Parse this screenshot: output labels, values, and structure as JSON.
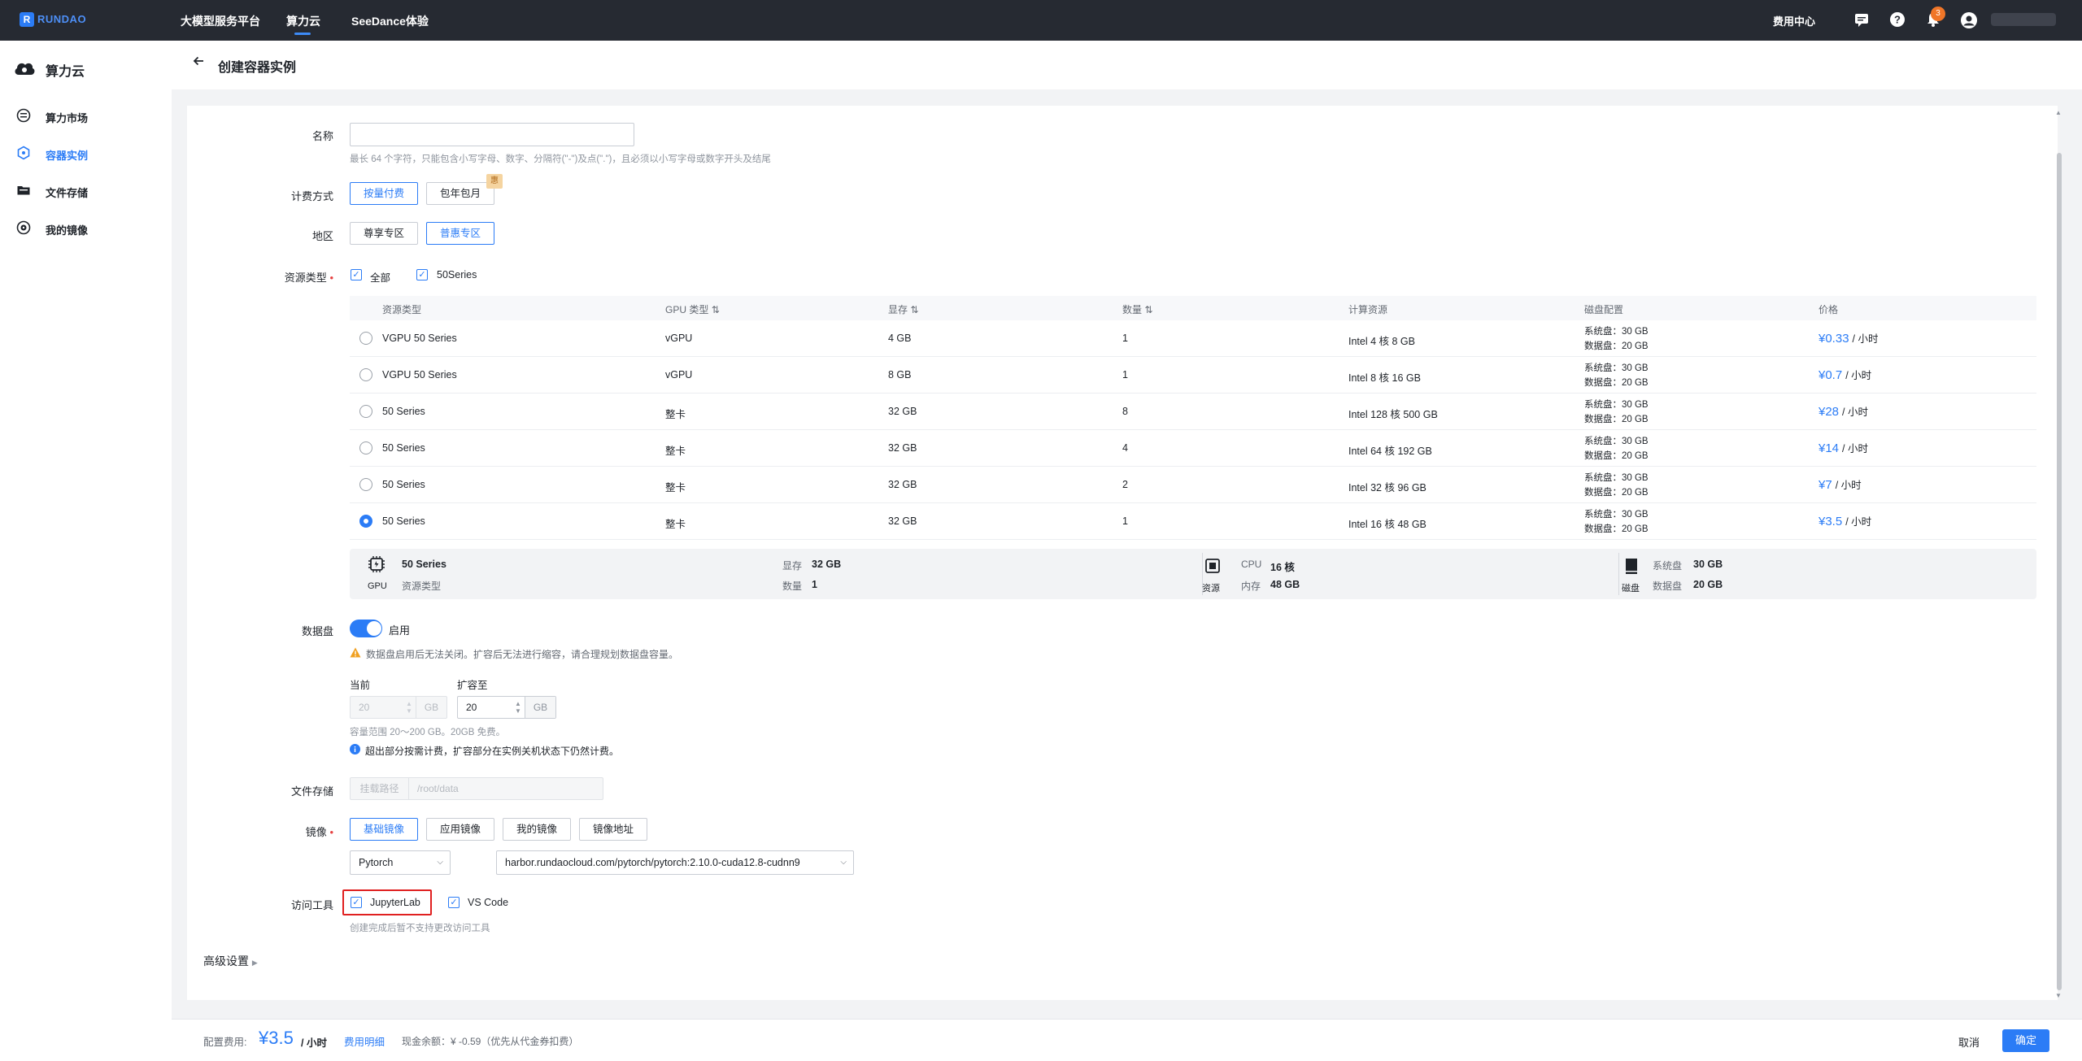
{
  "topbar": {
    "logo_text": "RUNDAO",
    "nav": [
      "大模型服务平台",
      "算力云",
      "SeeDance体验"
    ],
    "billing": "费用中心",
    "notifications": "3"
  },
  "sidebar": {
    "title": "算力云",
    "items": [
      "算力市场",
      "容器实例",
      "文件存储",
      "我的镜像"
    ]
  },
  "page": {
    "title": "创建容器实例"
  },
  "form": {
    "name_label": "名称",
    "name_value": "",
    "name_hint": "最长 64 个字符，只能包含小写字母、数字、分隔符(\"-\")及点(\".\")，且必须以小写字母或数字开头及结尾",
    "billing_label": "计费方式",
    "billing_options": [
      "按量付费",
      "包年包月"
    ],
    "billing_tag": "惠",
    "region_label": "地区",
    "region_options": [
      "尊享专区",
      "普惠专区"
    ],
    "resource_label": "资源类型",
    "resource_filters": [
      "全部",
      "50Series"
    ]
  },
  "table": {
    "headers": [
      "资源类型",
      "GPU 类型",
      "显存",
      "数量",
      "计算资源",
      "磁盘配置",
      "价格"
    ],
    "rows": [
      {
        "type": "VGPU 50 Series",
        "gpu": "vGPU",
        "mem": "4 GB",
        "count": "1",
        "cpu": "Intel 4 核 8 GB",
        "sys": "系统盘：30 GB",
        "data": "数据盘：20 GB",
        "price": "¥0.33",
        "unit": "/ 小时"
      },
      {
        "type": "VGPU 50 Series",
        "gpu": "vGPU",
        "mem": "8 GB",
        "count": "1",
        "cpu": "Intel 8 核 16 GB",
        "sys": "系统盘：30 GB",
        "data": "数据盘：20 GB",
        "price": "¥0.7",
        "unit": "/ 小时"
      },
      {
        "type": "50 Series",
        "gpu": "整卡",
        "mem": "32 GB",
        "count": "8",
        "cpu": "Intel 128 核 500 GB",
        "sys": "系统盘：30 GB",
        "data": "数据盘：20 GB",
        "price": "¥28",
        "unit": "/ 小时"
      },
      {
        "type": "50 Series",
        "gpu": "整卡",
        "mem": "32 GB",
        "count": "4",
        "cpu": "Intel 64 核 192 GB",
        "sys": "系统盘：30 GB",
        "data": "数据盘：20 GB",
        "price": "¥14",
        "unit": "/ 小时"
      },
      {
        "type": "50 Series",
        "gpu": "整卡",
        "mem": "32 GB",
        "count": "2",
        "cpu": "Intel 32 核 96 GB",
        "sys": "系统盘：30 GB",
        "data": "数据盘：20 GB",
        "price": "¥7",
        "unit": "/ 小时"
      },
      {
        "type": "50 Series",
        "gpu": "整卡",
        "mem": "32 GB",
        "count": "1",
        "cpu": "Intel 16 核 48 GB",
        "sys": "系统盘：30 GB",
        "data": "数据盘：20 GB",
        "price": "¥3.5",
        "unit": "/ 小时"
      }
    ],
    "selected_index": 5
  },
  "summary": {
    "gpu_icon_label": "GPU",
    "name": "50 Series",
    "name_sub": "资源类型",
    "mem_key": "显存",
    "mem_val": "32 GB",
    "count_key": "数量",
    "count_val": "1",
    "res_icon_label": "资源",
    "cpu_key": "CPU",
    "cpu_val": "16 核",
    "ram_key": "内存",
    "ram_val": "48 GB",
    "disk_icon_label": "磁盘",
    "sys_key": "系统盘",
    "sys_val": "30 GB",
    "data_key": "数据盘",
    "data_val": "20 GB"
  },
  "datadisk": {
    "label": "数据盘",
    "toggle_text": "启用",
    "warning": "数据盘启用后无法关闭。扩容后无法进行缩容，请合理规划数据盘容量。",
    "current_label": "当前",
    "current_value": "20",
    "expand_label": "扩容至",
    "expand_value": "20",
    "unit": "GB",
    "range_hint": "容量范围 20～200 GB。20GB 免费。",
    "billing_hint": "超出部分按需计费，扩容部分在实例关机状态下仍然计费。"
  },
  "storage": {
    "label": "文件存储",
    "mount_label": "挂载路径",
    "mount_placeholder": "/root/data"
  },
  "image": {
    "label": "镜像",
    "tabs": [
      "基础镜像",
      "应用镜像",
      "我的镜像",
      "镜像地址"
    ],
    "framework": "Pytorch",
    "address": "harbor.rundaocloud.com/pytorch/pytorch:2.10.0-cuda12.8-cudnn9"
  },
  "tools": {
    "label": "访问工具",
    "options": [
      "JupyterLab",
      "VS Code"
    ],
    "hint": "创建完成后暂不支持更改访问工具"
  },
  "advanced": "高级设置",
  "footer": {
    "cost_label": "配置费用:",
    "cost_value": "¥3.5",
    "cost_unit": "/ 小时",
    "detail_link": "费用明细",
    "balance": "现金余额：¥ -0.59（优先从代金券扣费）",
    "cancel": "取消",
    "confirm": "确定"
  }
}
